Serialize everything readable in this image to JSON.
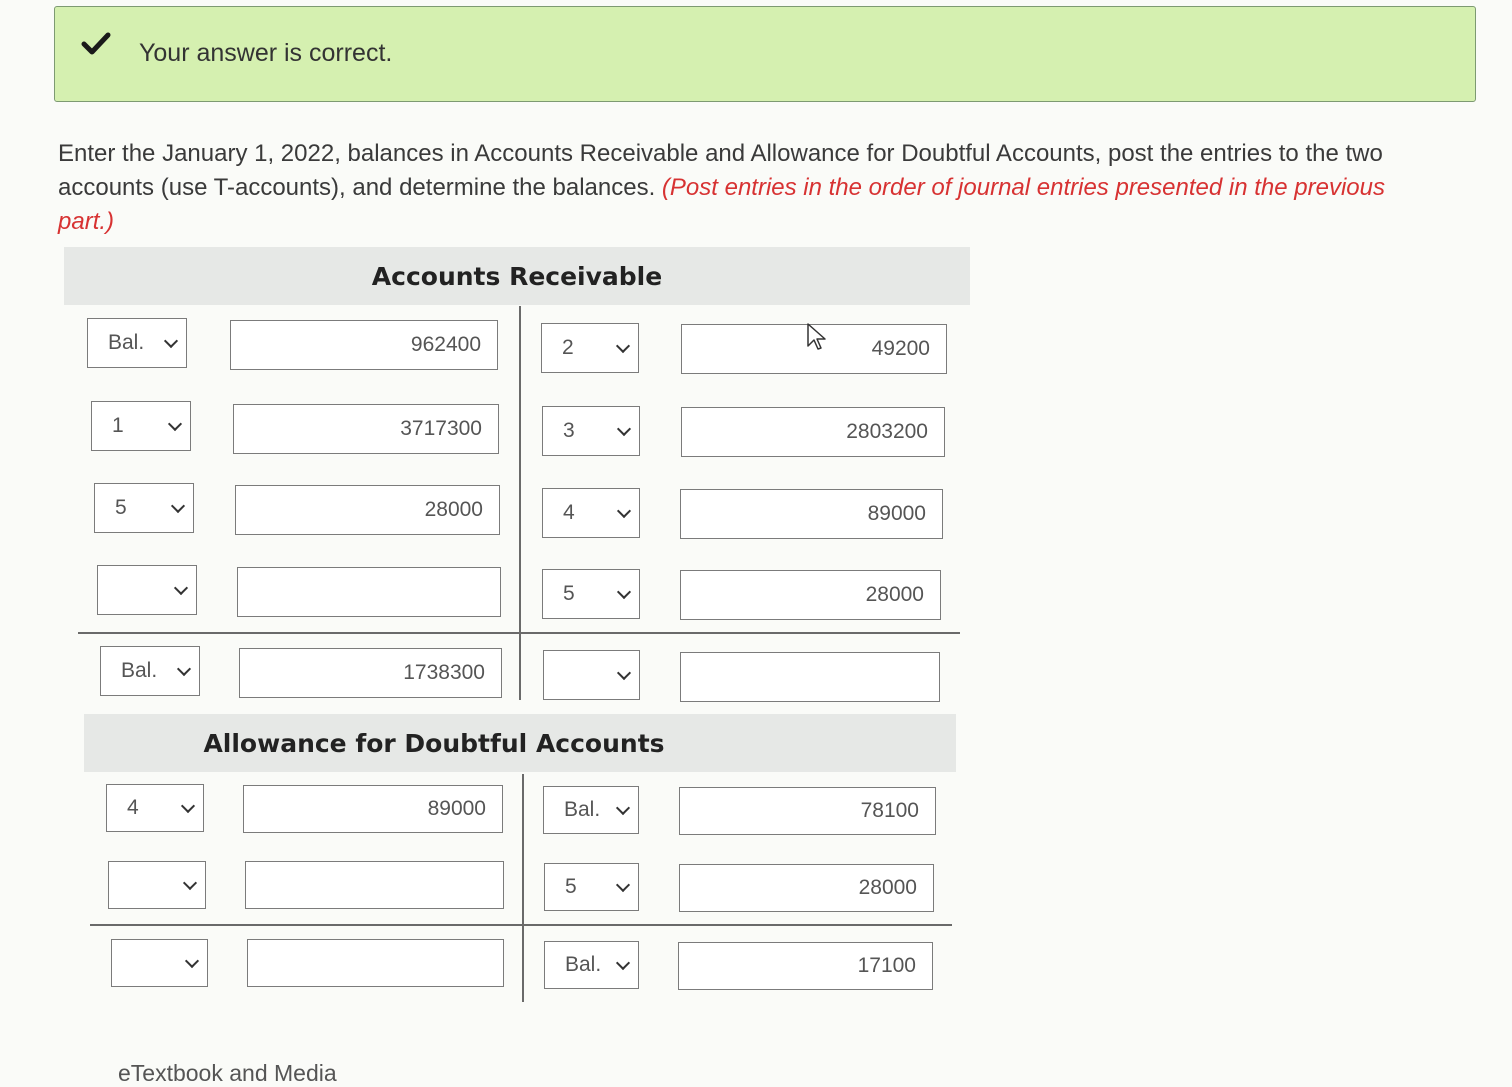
{
  "feedback": {
    "message": "Your answer is correct."
  },
  "instructions": {
    "text": "Enter the January 1, 2022, balances in Accounts Receivable and Allowance for Doubtful Accounts, post the entries to the two accounts (use T-accounts), and determine the balances.",
    "note": "(Post entries in the order of journal entries presented in the previous part.)"
  },
  "accounts_receivable": {
    "title": "Accounts Receivable",
    "rows": [
      {
        "left_ref": "Bal.",
        "left_amount": "962400",
        "right_ref": "2",
        "right_amount": "49200"
      },
      {
        "left_ref": "1",
        "left_amount": "3717300",
        "right_ref": "3",
        "right_amount": "2803200"
      },
      {
        "left_ref": "5",
        "left_amount": "28000",
        "right_ref": "4",
        "right_amount": "89000"
      },
      {
        "left_ref": "",
        "left_amount": "",
        "right_ref": "5",
        "right_amount": "28000"
      }
    ],
    "balance": {
      "left_ref": "Bal.",
      "left_amount": "1738300",
      "right_ref": "",
      "right_amount": ""
    }
  },
  "allowance": {
    "title": "Allowance for Doubtful Accounts",
    "rows": [
      {
        "left_ref": "4",
        "left_amount": "89000",
        "right_ref": "Bal.",
        "right_amount": "78100"
      },
      {
        "left_ref": "",
        "left_amount": "",
        "right_ref": "5",
        "right_amount": "28000"
      }
    ],
    "balance": {
      "left_ref": "",
      "left_amount": "",
      "right_ref": "Bal.",
      "right_amount": "17100"
    }
  },
  "footer": {
    "etextbook_label": "eTextbook and Media"
  },
  "colors": {
    "success_bg": "#d5f0b0",
    "check": "#1a1a1a",
    "note_red": "#d73232"
  }
}
